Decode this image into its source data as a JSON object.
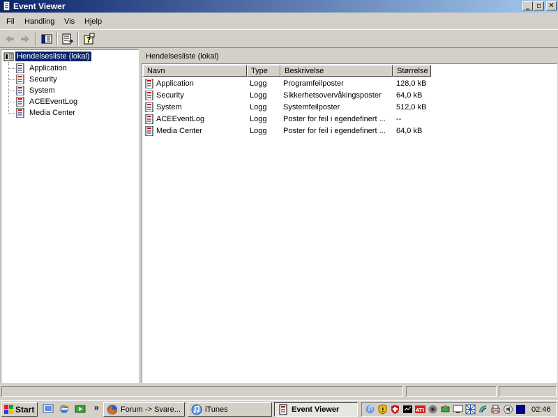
{
  "window": {
    "title": "Event Viewer"
  },
  "menu": {
    "items": [
      "Fil",
      "Handling",
      "Vis",
      "Hjelp"
    ]
  },
  "tree": {
    "root_label": "Hendelsesliste (lokal)",
    "children": [
      "Application",
      "Security",
      "System",
      "ACEEventLog",
      "Media Center"
    ]
  },
  "right_pane": {
    "header": "Hendelsesliste (lokal)"
  },
  "table": {
    "columns": [
      "Navn",
      "Type",
      "Beskrivelse",
      "Størrelse"
    ],
    "rows": [
      {
        "name": "Application",
        "type": "Logg",
        "description": "Programfeilposter",
        "size": "128,0 kB"
      },
      {
        "name": "Security",
        "type": "Logg",
        "description": "Sikkerhetsovervåkingsposter",
        "size": "64,0 kB"
      },
      {
        "name": "System",
        "type": "Logg",
        "description": "Systemfeilposter",
        "size": "512,0 kB"
      },
      {
        "name": "ACEEventLog",
        "type": "Logg",
        "description": "Poster for feil i egendefinert ...",
        "size": "--"
      },
      {
        "name": "Media Center",
        "type": "Logg",
        "description": "Poster for feil i egendefinert ...",
        "size": "64,0 kB"
      }
    ]
  },
  "taskbar": {
    "start_label": "Start",
    "overflow_label": "»",
    "tasks": [
      {
        "label": "Forum -> Svare..."
      },
      {
        "label": "iTunes"
      },
      {
        "label": "Event Viewer"
      }
    ],
    "clock": "02:46"
  },
  "colors": {
    "titlebar_start": "#0a246a",
    "titlebar_end": "#a6caf0",
    "face": "#d4d0c8",
    "selection": "#0a246a"
  }
}
